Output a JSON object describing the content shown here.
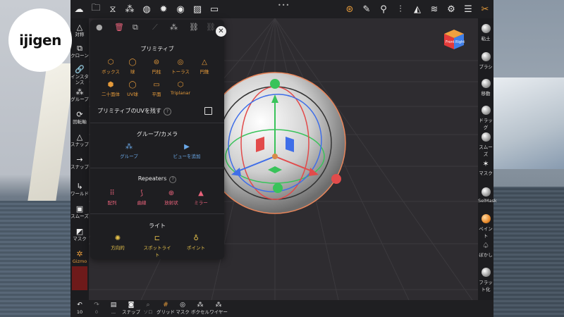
{
  "logo": {
    "text": "ijigen"
  },
  "topbar": {
    "icons": [
      "cloud-icon",
      "folder-icon",
      "share-node-icon",
      "scene-icon",
      "globe-icon",
      "sun-icon",
      "material-ball-icon",
      "image-icon",
      "video-icon"
    ],
    "right_icons": [
      "gizmo-icon",
      "brush-icon",
      "dropper-icon",
      "symmetry-icon",
      "wireframe-icon",
      "layers-icon",
      "settings-icon",
      "sliders-icon",
      "tools-icon"
    ],
    "handle": "•••"
  },
  "leftbar": [
    {
      "icon": "△",
      "label": "対称"
    },
    {
      "icon": "⧉",
      "label": "クローン"
    },
    {
      "icon": "🔗",
      "label": "インスタンス"
    },
    {
      "icon": "⁂",
      "label": "グループ"
    },
    {
      "icon": "⟳",
      "label": "回転軸"
    },
    {
      "icon": "△",
      "label": "スナップ"
    },
    {
      "icon": "→",
      "label": "スナップ"
    },
    {
      "icon": "↳",
      "label": "ワールド"
    },
    {
      "icon": "▣",
      "label": "スムーズ"
    },
    {
      "icon": "◩",
      "label": "マスク"
    },
    {
      "icon": "✲",
      "label": "Gizmo"
    }
  ],
  "rightbar": [
    {
      "kind": "ball",
      "label": "粘土"
    },
    {
      "kind": "ball",
      "label": "ブラシ"
    },
    {
      "kind": "ball",
      "label": "移動"
    },
    {
      "kind": "ball",
      "label": "ドラッグ"
    },
    {
      "kind": "ball",
      "label": "スムーズ"
    },
    {
      "kind": "glyph",
      "icon": "✶",
      "label": "マスク"
    },
    {
      "kind": "ball",
      "label": "SelMask"
    },
    {
      "kind": "orange",
      "label": "ペイント"
    },
    {
      "kind": "glyph",
      "icon": "♤",
      "label": "ぼかし"
    },
    {
      "kind": "ball",
      "label": "フラット化"
    }
  ],
  "bottombar": [
    {
      "icon": "↶",
      "label": "10"
    },
    {
      "icon": "↷",
      "label": "0"
    },
    {
      "icon": "▤",
      "label": "..."
    },
    {
      "icon": "◙",
      "label": "スナップ"
    },
    {
      "icon": "⌕",
      "label": "ソロ"
    },
    {
      "icon": "#",
      "label": "グリッド"
    },
    {
      "icon": "◎",
      "label": "マスク"
    },
    {
      "icon": "⁂",
      "label": "ボクセル"
    },
    {
      "icon": "⁂",
      "label": "ワイヤー"
    }
  ],
  "panel": {
    "toolbar_icons": [
      "trash-icon",
      "duplicate-icon",
      "connect-icon",
      "sculpt-icon",
      "link-icon",
      "unlink-icon",
      "unknown-icon"
    ],
    "primitives": {
      "title": "プリミティブ",
      "items": [
        {
          "icon": "⬡",
          "label": "ボックス"
        },
        {
          "icon": "◯",
          "label": "球"
        },
        {
          "icon": "⊜",
          "label": "円柱"
        },
        {
          "icon": "◎",
          "label": "トーラス"
        },
        {
          "icon": "△",
          "label": "円錐"
        },
        {
          "icon": "⬢",
          "label": "二十面体"
        },
        {
          "icon": "◯",
          "label": "UV球"
        },
        {
          "icon": "▭",
          "label": "平面"
        },
        {
          "icon": "⬡",
          "label": "Triplanar"
        }
      ]
    },
    "uv_label": "プリミティブのUVを残す",
    "uv_help": "?",
    "uv_checked": false,
    "group": {
      "title": "グループ/カメラ",
      "items": [
        {
          "icon": "⁂",
          "label": "グループ"
        },
        {
          "icon": "▶",
          "label": "ビューを追加"
        }
      ]
    },
    "repeaters": {
      "title": "Repeaters",
      "help": "?",
      "items": [
        {
          "icon": "⠿",
          "label": "配列"
        },
        {
          "icon": "⟆",
          "label": "曲線"
        },
        {
          "icon": "⊕",
          "label": "放射状"
        },
        {
          "icon": "▲",
          "label": "ミラー"
        }
      ]
    },
    "lights": {
      "title": "ライト",
      "items": [
        {
          "icon": "✺",
          "label": "方向的"
        },
        {
          "icon": "⊏",
          "label": "スポットライト"
        },
        {
          "icon": "♁",
          "label": "ポイント"
        }
      ]
    }
  },
  "nav_cube": {
    "left": "Front",
    "right": "Right"
  },
  "colors": {
    "accent": "#e59a3a",
    "blue": "#6aa8e8",
    "red": "#e8627a",
    "bg": "#2e2c30"
  }
}
